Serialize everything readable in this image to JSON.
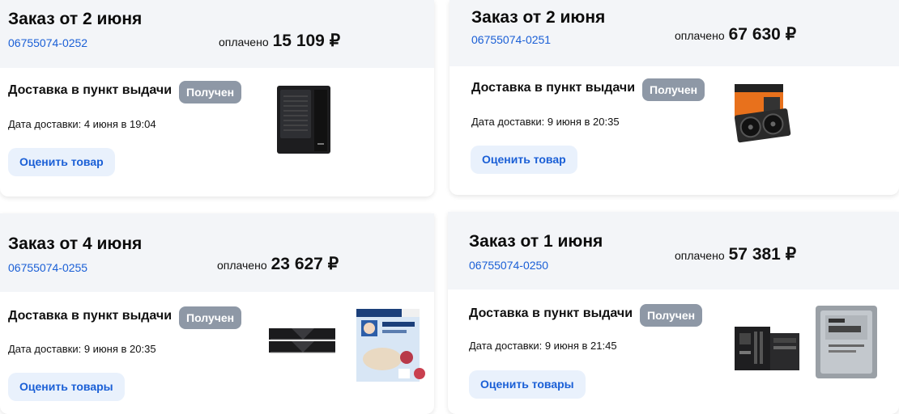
{
  "orders": [
    {
      "title": "Заказ от 2 июня",
      "number": "06755074-0252",
      "paid_label": "оплачено",
      "paid_sum": "15 109 ₽",
      "delivery": "Доставка в пункт выдачи",
      "status": "Получен",
      "date": "Дата доставки: 4 июня в 19:04",
      "rate_label": "Оценить товар",
      "products": [
        "pc-case-icon"
      ]
    },
    {
      "title": "Заказ от 2 июня",
      "number": "06755074-0251",
      "paid_label": "оплачено",
      "paid_sum": "67 630 ₽",
      "delivery": "Доставка в пункт выдачи",
      "status": "Получен",
      "date": "Дата доставки: 9 июня в 20:35",
      "rate_label": "Оценить товар",
      "products": [
        "graphics-card-icon"
      ]
    },
    {
      "title": "Заказ от 4 июня",
      "number": "06755074-0255",
      "paid_label": "оплачено",
      "paid_sum": "23 627 ₽",
      "delivery": "Доставка в пункт выдачи",
      "status": "Получен",
      "date": "Дата доставки: 9 июня в 20:35",
      "rate_label": "Оценить товары",
      "products": [
        "ram-modules-icon",
        "baby-food-box-icon"
      ]
    },
    {
      "title": "Заказ от 1 июня",
      "number": "06755074-0250",
      "paid_label": "оплачено",
      "paid_sum": "57 381 ₽",
      "delivery": "Доставка в пункт выдачи",
      "status": "Получен",
      "date": "Дата доставки: 9 июня в 21:45",
      "rate_label": "Оценить товары",
      "products": [
        "motherboard-icon",
        "cpu-icon"
      ]
    }
  ],
  "colors": {
    "accent": "#1a5fd6",
    "badge": "#8e98a6",
    "header_bg": "#f3f5f8",
    "button_bg": "#e9f1fc"
  }
}
